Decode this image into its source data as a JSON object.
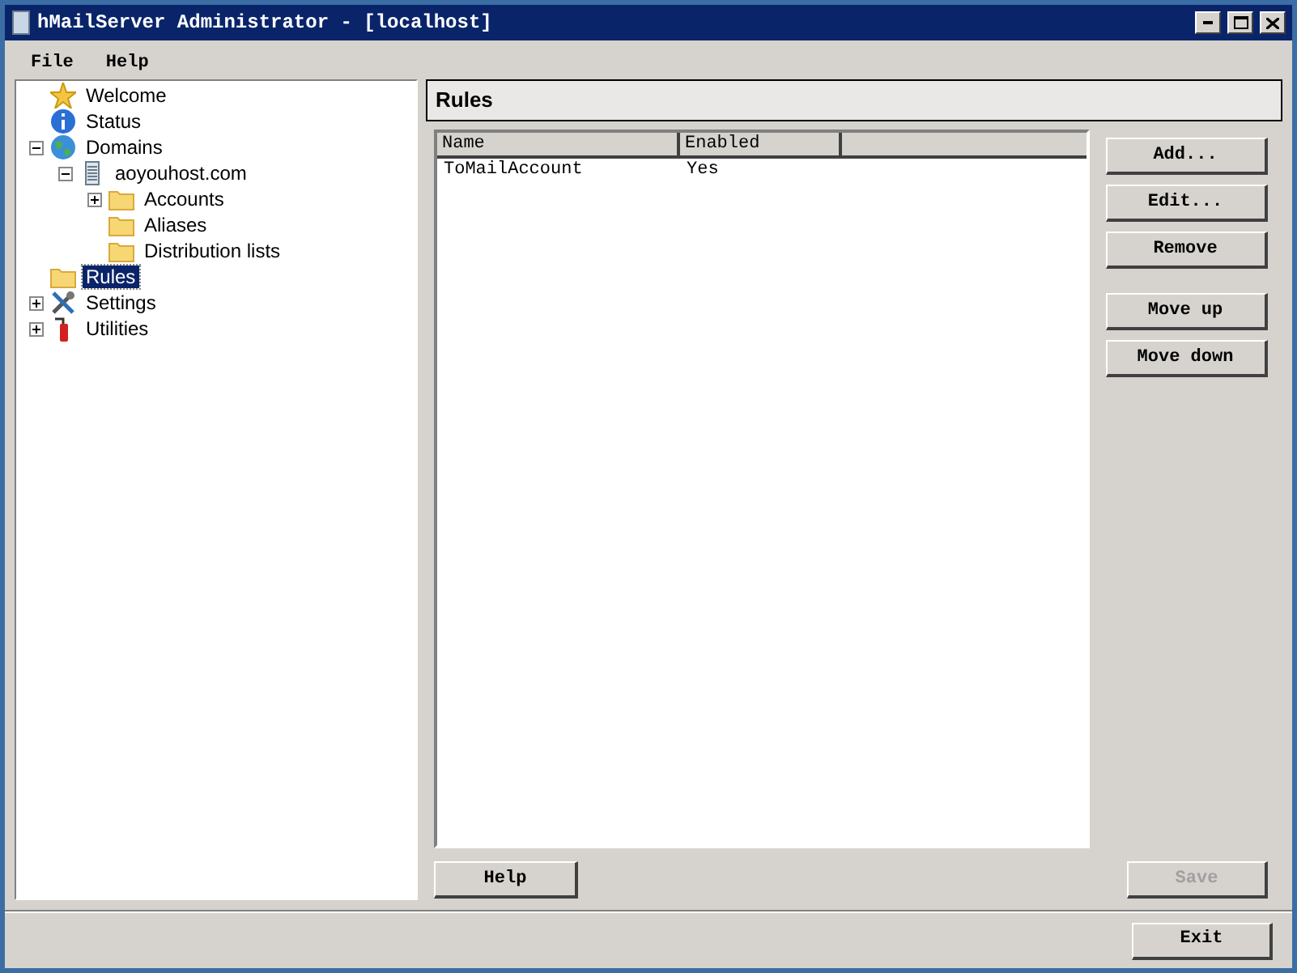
{
  "window": {
    "title": "hMailServer Administrator - [localhost]"
  },
  "menu": [
    {
      "label": "File"
    },
    {
      "label": "Help"
    }
  ],
  "tree": [
    {
      "label": "Welcome",
      "kind": "star",
      "selected": false
    },
    {
      "label": "Status",
      "kind": "info",
      "selected": false
    },
    {
      "label": "Domains",
      "kind": "globe",
      "selected": false,
      "expanded": true,
      "children": [
        {
          "label": "aoyouhost.com",
          "kind": "server",
          "selected": false,
          "expanded": true,
          "children": [
            {
              "label": "Accounts",
              "kind": "folder",
              "selected": false,
              "expanded": false
            },
            {
              "label": "Aliases",
              "kind": "folder",
              "selected": false
            },
            {
              "label": "Distribution lists",
              "kind": "folder",
              "selected": false
            }
          ]
        }
      ]
    },
    {
      "label": "Rules",
      "kind": "folder",
      "selected": true
    },
    {
      "label": "Settings",
      "kind": "tools",
      "selected": false,
      "expanded": false
    },
    {
      "label": "Utilities",
      "kind": "extinguisher",
      "selected": false,
      "expanded": false
    }
  ],
  "panel": {
    "title": "Rules",
    "table": {
      "columns": [
        "Name",
        "Enabled"
      ],
      "rows": [
        [
          "ToMailAccount",
          "Yes"
        ]
      ]
    },
    "side_buttons": [
      [
        {
          "label": "Add..."
        },
        {
          "label": "Edit..."
        },
        {
          "label": "Remove"
        }
      ],
      [
        {
          "label": "Move up"
        },
        {
          "label": "Move down"
        }
      ]
    ],
    "help_button": {
      "label": "Help"
    },
    "save_button": {
      "label": "Save",
      "disabled": true
    }
  },
  "exit_button": {
    "label": "Exit"
  }
}
